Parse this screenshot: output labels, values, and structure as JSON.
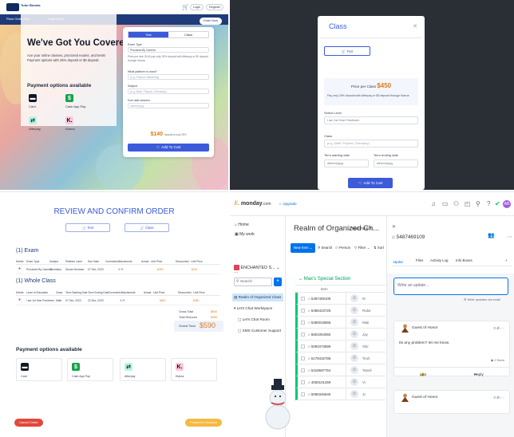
{
  "q1": {
    "brand": "Tutor\nBoosts",
    "top_login": "Login",
    "top_register": "Register",
    "nav_place": "Place Order Now",
    "nav_track": "Track Order",
    "nav_new": "Order Now",
    "hero_heading": "We've Got You Covered!",
    "hero_sub": "Ace your online classes, proctored exams, and tests! Payment options with 25% deposit or $0 deposit.",
    "pay_heading": "Payment options available",
    "pay": [
      "Card",
      "Cash App Pay",
      "Afterpay",
      "Klarna"
    ],
    "tab_test": "Test",
    "tab_class": "Class",
    "exam_type_label": "Exam Type",
    "exam_type_value": "Proctored By Camera",
    "price_note": "Price per test: $140 pay only 25% deposit with Afterpay or $0 deposit through Klarna",
    "platform_label": "What platform is used?",
    "platform_placeholder": "(e.g. Pearson Mastering)",
    "subject_label": "Subject",
    "subject_placeholder": "(e.g. Math, Physics, Chemistry)",
    "due_label": "Due date session",
    "due_placeholder": "dd/mm/yyyy",
    "price": "$140",
    "price_note2": "deposit is only 25%",
    "add_cart": "Add To Cart"
  },
  "q2": {
    "title": "Class",
    "tab_test": "Test",
    "price_label": "Price per Class",
    "price": "$450",
    "deposit_note": "Pay only 25% deposit with Afterpay or $0 deposit through Klarna",
    "level_label": "Select Level",
    "level_value": "I am 1st Year Freshmen",
    "class_label": "Class",
    "class_placeholder": "(e.g. Math, Physics, Chemistry)",
    "start_label": "Term starting date",
    "end_label": "Term ending date",
    "date_placeholder": "dd/mm/yyyy",
    "add_cart": "Add To Cart"
  },
  "q3": {
    "title": "REVIEW AND CONFIRM ORDER",
    "tab_test": "Test",
    "tab_class": "Class",
    "exam_heading": "(1) Exam",
    "exam_cols": [
      "Delete",
      "Exam Type",
      "Subject",
      "Platform Used",
      "Due Date",
      "Comment/Attachments",
      "Actual - Unit Price",
      "Discounted - Unit Price"
    ],
    "exam_row": [
      "Proctored By Camera",
      "Chemistry",
      "Secure Browser",
      "07 Dec, 2023",
      "$180",
      "$140"
    ],
    "class_heading": "(1) Whole Class",
    "class_cols": [
      "Delete",
      "Level of Education",
      "Class",
      "Term Starting Date",
      "Term Ending Date",
      "Comment/Attachments",
      "Actual - Unit Price",
      "Discounted - Unit Price"
    ],
    "class_row": [
      "I am 1st Year Freshmen",
      "Math",
      "07 Dec, 2023",
      "22 Dec, 2023",
      "$600",
      "$450"
    ],
    "gross_label": "Gross Total",
    "gross_value": "$840",
    "discount_label": "Total Discount",
    "discount_value": "$250",
    "grand_label": "Grand Total",
    "grand_value": "$590",
    "pay_heading": "Payment options available",
    "pay": [
      "Card",
      "Cash App Pay",
      "Afterpay",
      "Klarna"
    ],
    "cancel": "Cancel Order",
    "proceed": "Proceed to Checkout"
  },
  "q4": {
    "logo": "monday",
    "logo_suffix": ".com",
    "upgrade": "Upgrade",
    "home": "Home",
    "my_work": "My work",
    "workspace": "ENCHANTED S...",
    "search": "Search",
    "boards": [
      "Realm of Organized Class",
      "Let's Chat Workspace",
      "Let's Chat Room",
      "SMS Customer Support"
    ],
    "board_title": "Realm of Organized Ch...",
    "main_table": "Main Table",
    "new_item": "New Item",
    "tb_search": "Search",
    "tb_person": "Person",
    "tb_filter": "Filter",
    "tb_sort": "Sort",
    "group": "Max's Special Section",
    "col_item": "Item",
    "rows": [
      "5487469109",
      "5486423725",
      "5380018566",
      "5601054060",
      "5093473599",
      "5178432786",
      "5318697754",
      "4006101259",
      "5096346640"
    ],
    "row_names": [
      "M",
      "Ruba",
      "Mati",
      "Jay",
      "Shir",
      "Teoh",
      "Taneil",
      "Vi",
      "Jc"
    ],
    "panel_id": "5487469109",
    "panel_tabs": [
      "Updat",
      "Files",
      "Activity Log",
      "Info Boxes"
    ],
    "write_placeholder": "Write an update...",
    "write_email": "Write updates via email",
    "guest": "Guest of Honor",
    "time": "0 4h",
    "message": "Its any problem? let me know",
    "seen": "2 Seen",
    "like": "Like",
    "reply": "Reply"
  }
}
